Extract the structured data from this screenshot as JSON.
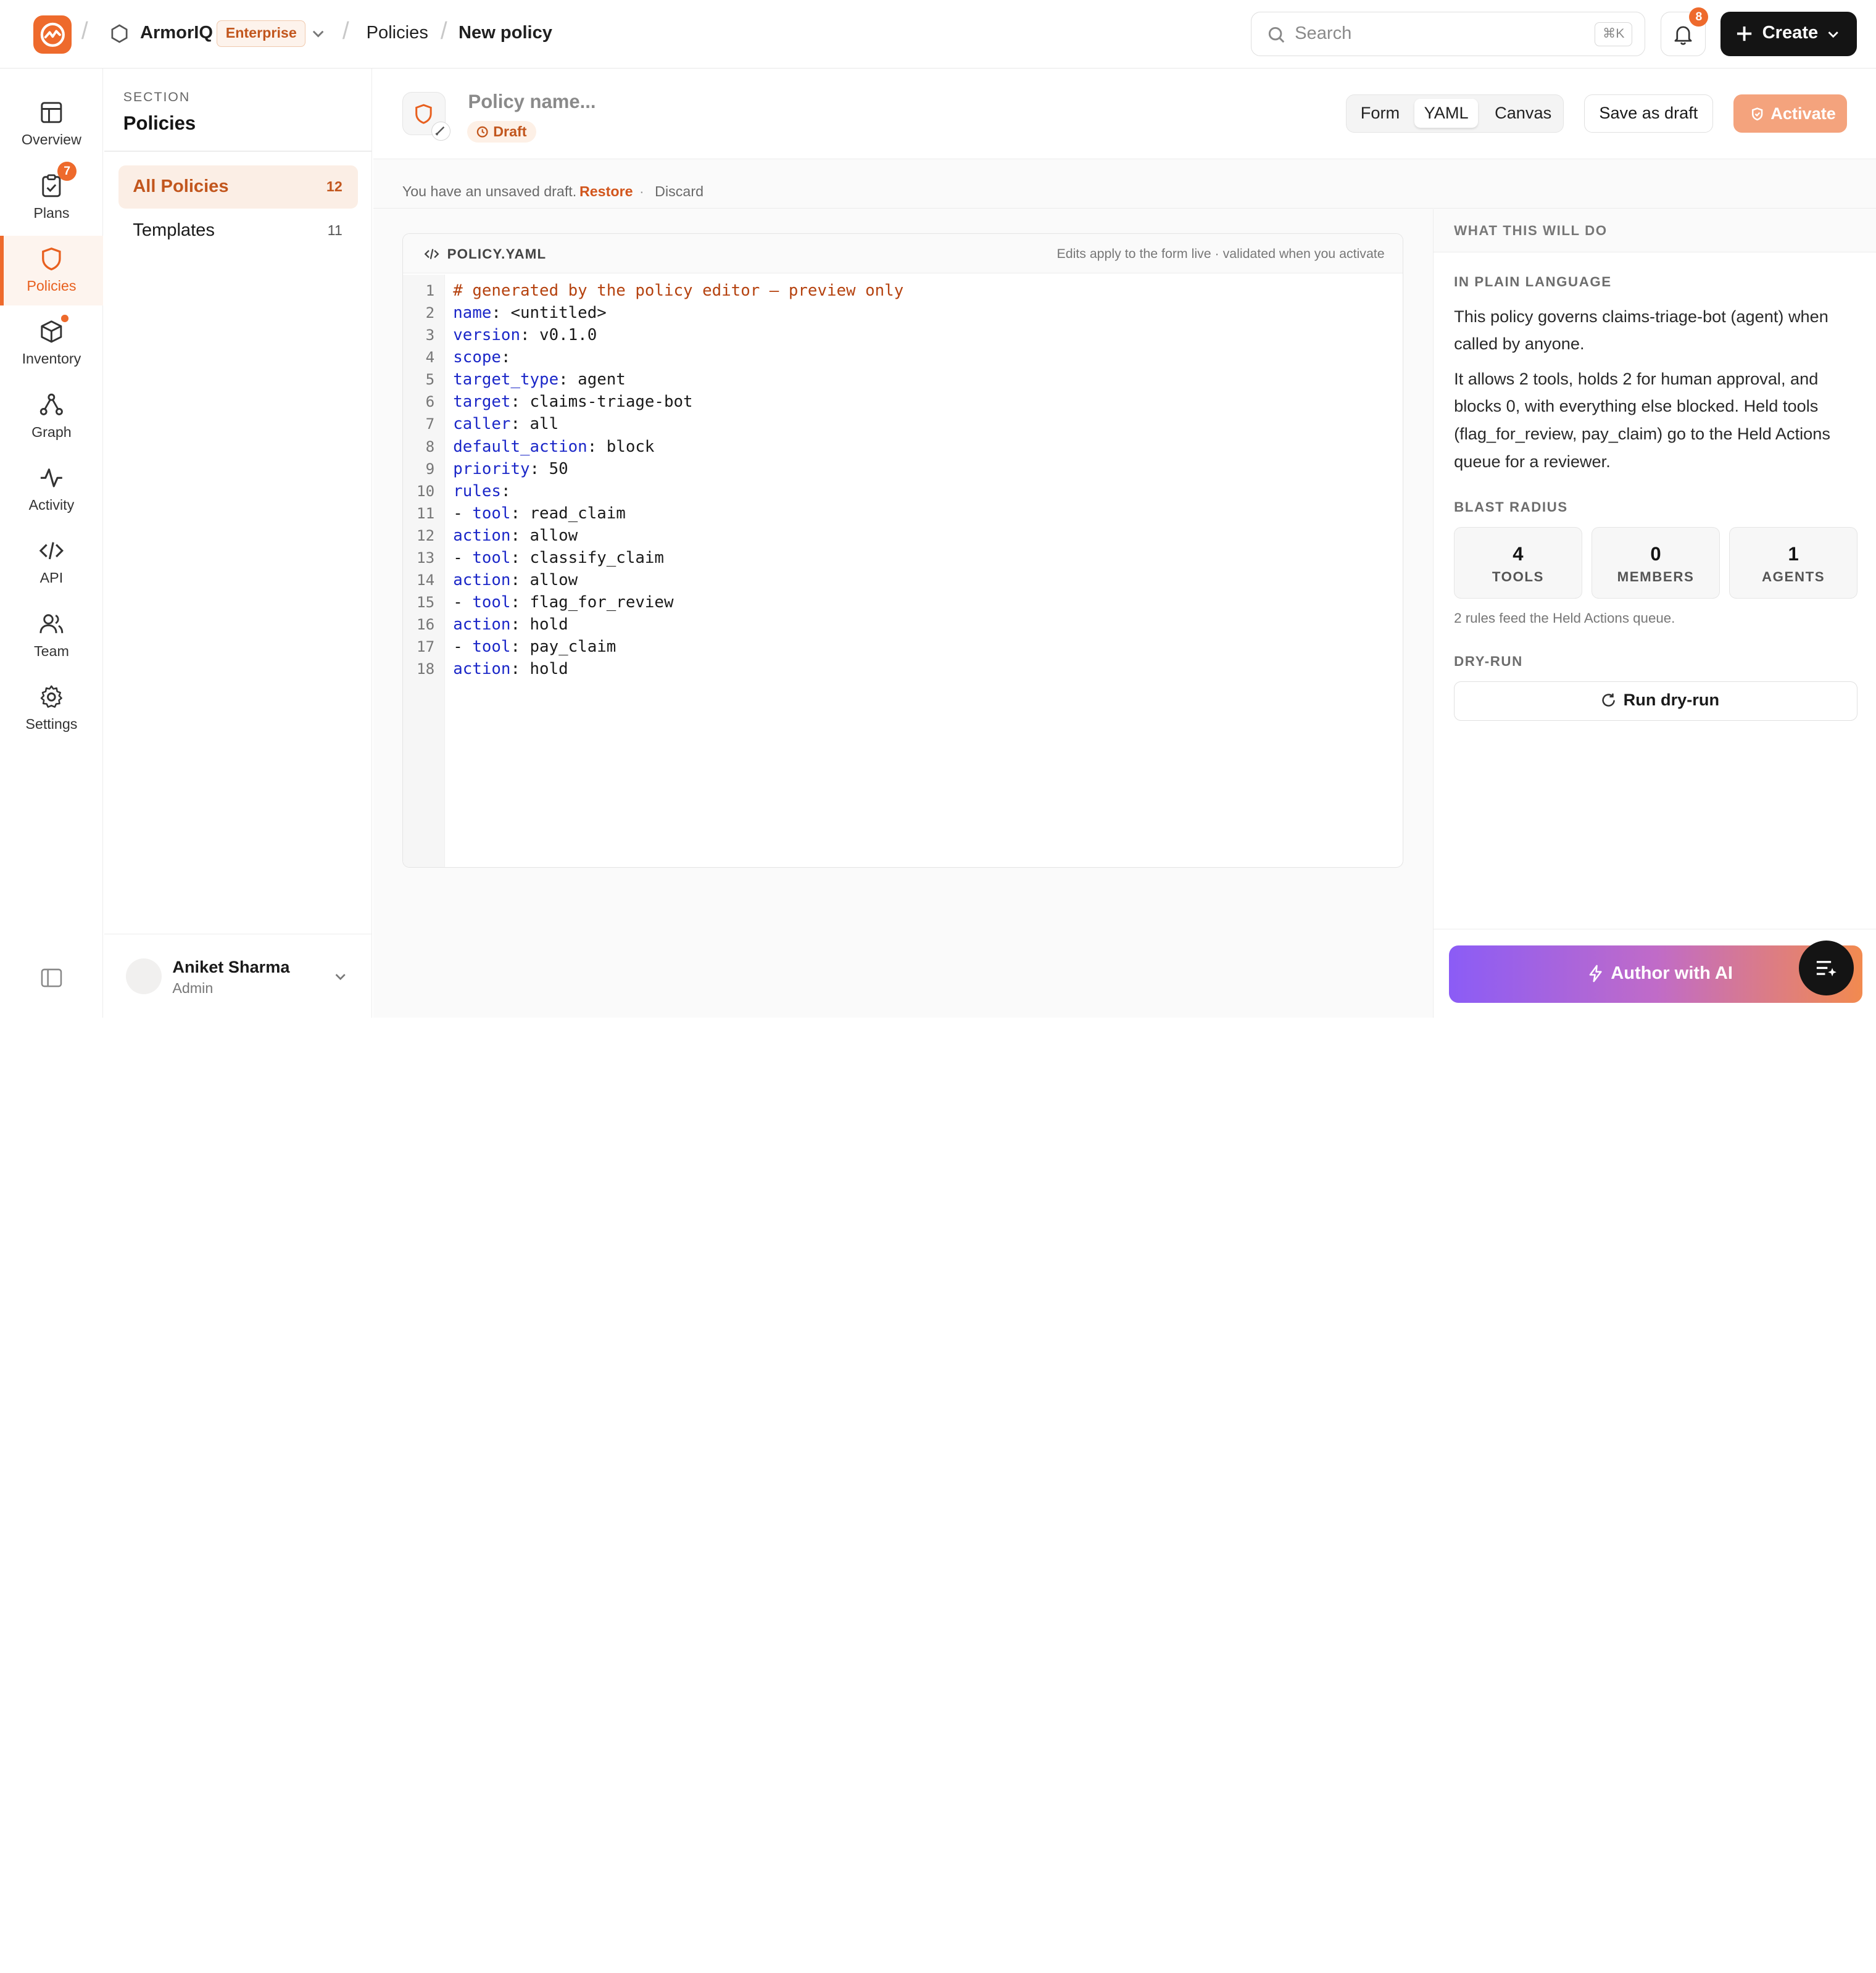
{
  "topbar": {
    "org": "ArmorIQ",
    "plan_badge": "Enterprise",
    "crumb_policies": "Policies",
    "crumb_current": "New policy",
    "search_placeholder": "Search",
    "search_shortcut": "⌘K",
    "notification_count": "8",
    "create_label": "Create"
  },
  "rail": {
    "items": [
      {
        "label": "Overview"
      },
      {
        "label": "Plans",
        "badge": "7"
      },
      {
        "label": "Policies"
      },
      {
        "label": "Inventory"
      },
      {
        "label": "Graph"
      },
      {
        "label": "Activity"
      },
      {
        "label": "API"
      },
      {
        "label": "Team"
      },
      {
        "label": "Settings"
      }
    ],
    "active": "Policies"
  },
  "section": {
    "caption": "SECTION",
    "title": "Policies",
    "items": [
      {
        "label": "All Policies",
        "count": "12"
      },
      {
        "label": "Templates",
        "count": "11"
      }
    ],
    "user": {
      "name": "Aniket Sharma",
      "role": "Admin"
    }
  },
  "header": {
    "policy_name_placeholder": "Policy name...",
    "status": "Draft",
    "views": [
      "Form",
      "YAML",
      "Canvas"
    ],
    "active_view": "YAML",
    "save_draft": "Save as draft",
    "activate": "Activate"
  },
  "unsaved": {
    "message": "You have an unsaved draft.",
    "restore": "Restore",
    "separator": "·",
    "discard": "Discard"
  },
  "editor": {
    "filename": "POLICY.YAML",
    "hint": "Edits apply to the form live · validated when you activate",
    "lines": [
      {
        "n": "1",
        "key": "",
        "text": "# generated by the policy editor — preview only",
        "comment": true
      },
      {
        "n": "2",
        "key": "name",
        "text": ": <untitled>"
      },
      {
        "n": "3",
        "key": "version",
        "text": ": v0.1.0"
      },
      {
        "n": "4",
        "key": "scope",
        "text": ":"
      },
      {
        "n": "5",
        "key": "target_type",
        "text": ": agent"
      },
      {
        "n": "6",
        "key": "target",
        "text": ": claims-triage-bot"
      },
      {
        "n": "7",
        "key": "caller",
        "text": ": all"
      },
      {
        "n": "8",
        "key": "default_action",
        "text": ": block"
      },
      {
        "n": "9",
        "key": "priority",
        "text": ": 50"
      },
      {
        "n": "10",
        "key": "rules",
        "text": ":"
      },
      {
        "n": "11",
        "prefix": "- ",
        "key": "tool",
        "text": ": read_claim"
      },
      {
        "n": "12",
        "key": "action",
        "text": ": allow"
      },
      {
        "n": "13",
        "prefix": "- ",
        "key": "tool",
        "text": ": classify_claim"
      },
      {
        "n": "14",
        "key": "action",
        "text": ": allow"
      },
      {
        "n": "15",
        "prefix": "- ",
        "key": "tool",
        "text": ": flag_for_review"
      },
      {
        "n": "16",
        "key": "action",
        "text": ": hold"
      },
      {
        "n": "17",
        "prefix": "- ",
        "key": "tool",
        "text": ": pay_claim"
      },
      {
        "n": "18",
        "key": "action",
        "text": ": hold"
      }
    ]
  },
  "summary": {
    "heading": "WHAT THIS WILL DO",
    "plain_caption": "IN PLAIN LANGUAGE",
    "para1": "This policy governs claims-triage-bot (agent) when called by anyone.",
    "para2": "It allows 2 tools, holds 2 for human approval, and blocks 0, with everything else blocked. Held tools (flag_for_review, pay_claim) go to the Held Actions queue for a reviewer.",
    "blast_caption": "BLAST RADIUS",
    "stats": [
      {
        "value": "4",
        "label": "TOOLS"
      },
      {
        "value": "0",
        "label": "MEMBERS"
      },
      {
        "value": "1",
        "label": "AGENTS"
      }
    ],
    "blast_note": "2 rules feed the Held Actions queue.",
    "dry_caption": "DRY-RUN",
    "dry_button": "Run dry-run",
    "ai_button": "Author with AI"
  },
  "colors": {
    "accent": "#ee6a2c",
    "keyword": "#1b27c8",
    "comment": "#b5420f"
  }
}
